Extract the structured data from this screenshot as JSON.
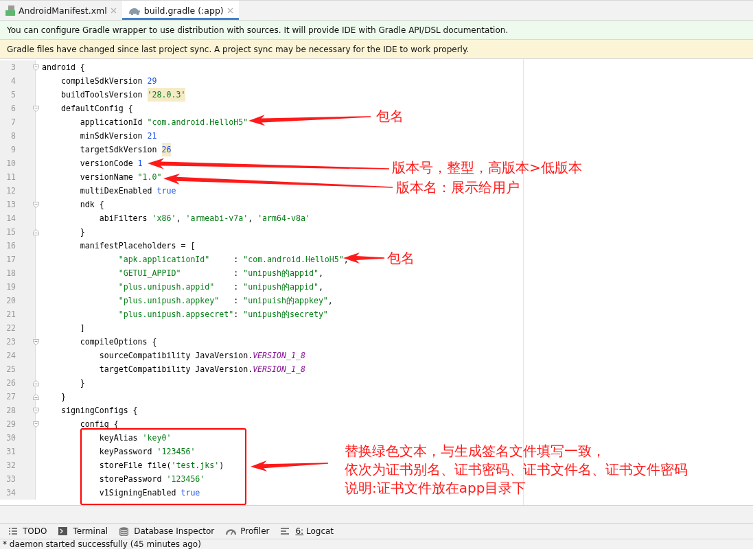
{
  "tabs": [
    {
      "label": "AndroidManifest.xml",
      "selected": false
    },
    {
      "label": "build.gradle (:app)",
      "selected": true
    }
  ],
  "banners": [
    {
      "kind": "info",
      "text": "You can configure Gradle wrapper to use distribution with sources. It will provide IDE with Gradle API/DSL documentation."
    },
    {
      "kind": "warning",
      "text": "Gradle files have changed since last project sync. A project sync may be necessary for the IDE to work properly."
    }
  ],
  "editor": {
    "lines": [
      {
        "no": "3",
        "kind": "fold_start",
        "tokens": [
          {
            "text": "android {",
            "kind": "plain"
          }
        ]
      },
      {
        "no": "4",
        "kind": "code",
        "tokens": [
          {
            "text": "    compileSdkVersion ",
            "kind": "plain"
          },
          {
            "text": "29",
            "kind": "num"
          }
        ]
      },
      {
        "no": "5",
        "kind": "code",
        "tokens": [
          {
            "text": "    buildToolsVersion ",
            "kind": "plain"
          },
          {
            "text": "'28.0.3'",
            "kind": "str",
            "highlighted": true
          }
        ]
      },
      {
        "no": "6",
        "kind": "fold_start",
        "tokens": [
          {
            "text": "    defaultConfig {",
            "kind": "plain"
          }
        ]
      },
      {
        "no": "7",
        "kind": "code",
        "tokens": [
          {
            "text": "        applicationId ",
            "kind": "plain"
          },
          {
            "text": "\"com.android.HelloH5\"",
            "kind": "str"
          }
        ]
      },
      {
        "no": "8",
        "kind": "code",
        "tokens": [
          {
            "text": "        minSdkVersion ",
            "kind": "plain"
          },
          {
            "text": "21",
            "kind": "num"
          }
        ]
      },
      {
        "no": "9",
        "kind": "code",
        "tokens": [
          {
            "text": "        targetSdkVersion ",
            "kind": "plain"
          },
          {
            "text": "26",
            "kind": "num",
            "highlighted": true
          }
        ]
      },
      {
        "no": "10",
        "kind": "code",
        "tokens": [
          {
            "text": "        versionCode ",
            "kind": "plain"
          },
          {
            "text": "1",
            "kind": "num"
          }
        ]
      },
      {
        "no": "11",
        "kind": "code",
        "tokens": [
          {
            "text": "        versionName ",
            "kind": "plain"
          },
          {
            "text": "\"1.0\"",
            "kind": "str"
          }
        ]
      },
      {
        "no": "12",
        "kind": "code",
        "tokens": [
          {
            "text": "        multiDexEnabled ",
            "kind": "plain"
          },
          {
            "text": "true",
            "kind": "num"
          }
        ]
      },
      {
        "no": "13",
        "kind": "fold_start",
        "tokens": [
          {
            "text": "        ndk {",
            "kind": "plain"
          }
        ]
      },
      {
        "no": "14",
        "kind": "code",
        "tokens": [
          {
            "text": "            abiFilters ",
            "kind": "plain"
          },
          {
            "text": "'x86'",
            "kind": "str"
          },
          {
            "text": ", ",
            "kind": "plain"
          },
          {
            "text": "'armeabi-v7a'",
            "kind": "str"
          },
          {
            "text": ", ",
            "kind": "plain"
          },
          {
            "text": "'arm64-v8a'",
            "kind": "str"
          }
        ]
      },
      {
        "no": "15",
        "kind": "fold_end",
        "tokens": [
          {
            "text": "        }",
            "kind": "plain"
          }
        ]
      },
      {
        "no": "16",
        "kind": "code",
        "tokens": [
          {
            "text": "        manifestPlaceholders = [",
            "kind": "plain"
          }
        ]
      },
      {
        "no": "17",
        "kind": "code",
        "tokens": [
          {
            "text": "                \"apk.applicationId\"",
            "kind": "str"
          },
          {
            "text": "     : ",
            "kind": "plain"
          },
          {
            "text": "\"com.android.HelloH5\"",
            "kind": "str"
          },
          {
            "text": ",",
            "kind": "plain"
          }
        ]
      },
      {
        "no": "18",
        "kind": "code",
        "tokens": [
          {
            "text": "                \"GETUI_APPID\"",
            "kind": "str"
          },
          {
            "text": "           : ",
            "kind": "plain"
          },
          {
            "text": "\"unipush的appid\"",
            "kind": "str"
          },
          {
            "text": ",",
            "kind": "plain"
          }
        ]
      },
      {
        "no": "19",
        "kind": "code",
        "tokens": [
          {
            "text": "                \"plus.unipush.appid\"",
            "kind": "str"
          },
          {
            "text": "    : ",
            "kind": "plain"
          },
          {
            "text": "\"unipush的appid\"",
            "kind": "str"
          },
          {
            "text": ",",
            "kind": "plain"
          }
        ]
      },
      {
        "no": "20",
        "kind": "code",
        "tokens": [
          {
            "text": "                \"plus.unipush.appkey\"",
            "kind": "str"
          },
          {
            "text": "   : ",
            "kind": "plain"
          },
          {
            "text": "\"unipuish的appkey\"",
            "kind": "str"
          },
          {
            "text": ",",
            "kind": "plain"
          }
        ]
      },
      {
        "no": "21",
        "kind": "code",
        "tokens": [
          {
            "text": "                \"plus.unipush.appsecret\"",
            "kind": "str"
          },
          {
            "text": ": ",
            "kind": "plain"
          },
          {
            "text": "\"unipush的secrety\"",
            "kind": "str"
          }
        ]
      },
      {
        "no": "22",
        "kind": "code",
        "tokens": [
          {
            "text": "        ]",
            "kind": "plain"
          }
        ]
      },
      {
        "no": "23",
        "kind": "fold_start",
        "tokens": [
          {
            "text": "        compileOptions {",
            "kind": "plain"
          }
        ]
      },
      {
        "no": "24",
        "kind": "code",
        "tokens": [
          {
            "text": "            sourceCompatibility JavaVersion.",
            "kind": "plain"
          },
          {
            "text": "VERSION_1_8",
            "kind": "const"
          }
        ]
      },
      {
        "no": "25",
        "kind": "code",
        "tokens": [
          {
            "text": "            targetCompatibility JavaVersion.",
            "kind": "plain"
          },
          {
            "text": "VERSION_1_8",
            "kind": "const"
          }
        ]
      },
      {
        "no": "26",
        "kind": "fold_end",
        "tokens": [
          {
            "text": "        }",
            "kind": "plain"
          }
        ]
      },
      {
        "no": "27",
        "kind": "fold_end",
        "tokens": [
          {
            "text": "    }",
            "kind": "plain"
          }
        ]
      },
      {
        "no": "28",
        "kind": "fold_start",
        "tokens": [
          {
            "text": "    signingConfigs {",
            "kind": "plain"
          }
        ]
      },
      {
        "no": "29",
        "kind": "fold_start",
        "tokens": [
          {
            "text": "        config {",
            "kind": "plain"
          }
        ]
      },
      {
        "no": "30",
        "kind": "code",
        "tokens": [
          {
            "text": "            keyAlias ",
            "kind": "plain"
          },
          {
            "text": "'key0'",
            "kind": "str"
          }
        ]
      },
      {
        "no": "31",
        "kind": "code",
        "tokens": [
          {
            "text": "            keyPassword ",
            "kind": "plain"
          },
          {
            "text": "'123456'",
            "kind": "str"
          }
        ]
      },
      {
        "no": "32",
        "kind": "code",
        "tokens": [
          {
            "text": "            storeFile file(",
            "kind": "plain"
          },
          {
            "text": "'test.jks'",
            "kind": "str"
          },
          {
            "text": ")",
            "kind": "plain"
          }
        ]
      },
      {
        "no": "33",
        "kind": "code",
        "tokens": [
          {
            "text": "            storePassword ",
            "kind": "plain"
          },
          {
            "text": "'123456'",
            "kind": "str"
          }
        ]
      },
      {
        "no": "34",
        "kind": "code",
        "tokens": [
          {
            "text": "            v1SigningEnabled ",
            "kind": "plain"
          },
          {
            "text": "true",
            "kind": "num"
          }
        ]
      }
    ]
  },
  "annotations": [
    {
      "text": "包名"
    },
    {
      "text": "版本号，整型，高版本>低版本"
    },
    {
      "text": "版本名：展示给用户"
    },
    {
      "text": "包名"
    },
    {
      "text": "替换绿色文本，与生成签名文件填写一致，"
    },
    {
      "text": "依次为证书别名、证书密码、证书文件名、证书文件密码"
    },
    {
      "text": "说明:证书文件放在app目录下"
    }
  ],
  "tool_windows": [
    {
      "label": "TODO",
      "mnemonic": false
    },
    {
      "label": "Terminal",
      "mnemonic": false
    },
    {
      "label": "Database Inspector",
      "mnemonic": false
    },
    {
      "label": "Profiler",
      "mnemonic": false
    },
    {
      "label": "6: Logcat",
      "mnemonic": true
    }
  ],
  "status_bar": {
    "text": "* daemon started successfully (45 minutes ago)"
  }
}
